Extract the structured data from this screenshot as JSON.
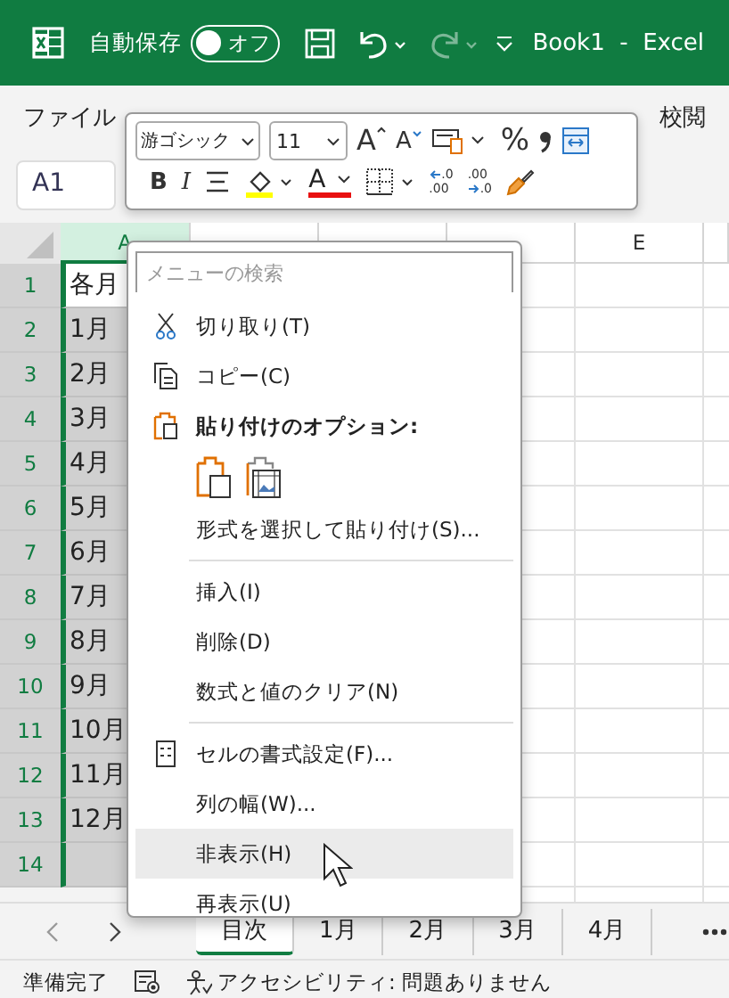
{
  "title_bar": {
    "autosave_label": "自動保存",
    "autosave": {
      "label": "オフ",
      "on": false
    },
    "redo_disabled": true,
    "title": "Book1  -  Excel"
  },
  "ribbon_tabs": [
    {
      "label": "ファイル"
    },
    {
      "label": "校閲"
    }
  ],
  "name_box": "A1",
  "mini_toolbar": {
    "font_name": "游ゴシック",
    "font_size": "11",
    "grow_font": "A",
    "shrink_font": "A",
    "percent": "%",
    "bold": "B",
    "italic": "I",
    "font_color": "A",
    "increase_decimal": {
      "upper": ".0",
      "lower": ".00"
    },
    "decrease_decimal": {
      "upper": ".00",
      "lower": ".0"
    }
  },
  "columns": [
    {
      "label": "A",
      "selected": true
    },
    {
      "label": "E",
      "selected": false
    }
  ],
  "rows": [
    {
      "number": "1",
      "value": "各月",
      "active": true
    },
    {
      "number": "2",
      "value": "1月",
      "active": false
    },
    {
      "number": "3",
      "value": "2月",
      "active": false
    },
    {
      "number": "4",
      "value": "3月",
      "active": false
    },
    {
      "number": "5",
      "value": "4月",
      "active": false
    },
    {
      "number": "6",
      "value": "5月",
      "active": false
    },
    {
      "number": "7",
      "value": "6月",
      "active": false
    },
    {
      "number": "8",
      "value": "7月",
      "active": false
    },
    {
      "number": "9",
      "value": "8月",
      "active": false
    },
    {
      "number": "10",
      "value": "9月",
      "active": false
    },
    {
      "number": "11",
      "value": "10月",
      "active": false
    },
    {
      "number": "12",
      "value": "11月",
      "active": false
    },
    {
      "number": "13",
      "value": "12月",
      "active": false
    },
    {
      "number": "14",
      "active": false
    }
  ],
  "context_menu": {
    "search_placeholder": "メニューの検索",
    "items": [
      {
        "kind": "cut",
        "label": "切り取り(T)",
        "hovered": false
      },
      {
        "kind": "copy",
        "label": "コピー(C)",
        "hovered": false
      },
      {
        "kind": "heading",
        "label": "貼り付けのオプション:",
        "hovered": false
      },
      {
        "kind": "paste-options"
      },
      {
        "kind": "plain",
        "label": "形式を選択して貼り付け(S)...",
        "hovered": false
      },
      {
        "kind": "separator"
      },
      {
        "kind": "plain",
        "label": "挿入(I)",
        "hovered": false
      },
      {
        "kind": "plain",
        "label": "削除(D)",
        "hovered": false
      },
      {
        "kind": "plain",
        "label": "数式と値のクリア(N)",
        "hovered": false
      },
      {
        "kind": "separator"
      },
      {
        "kind": "format",
        "label": "セルの書式設定(F)...",
        "hovered": false
      },
      {
        "kind": "plain",
        "label": "列の幅(W)...",
        "hovered": false
      },
      {
        "kind": "plain",
        "label": "非表示(H)",
        "hovered": true
      },
      {
        "kind": "plain",
        "label": "再表示(U)",
        "hovered": false
      }
    ]
  },
  "sheet_tabs": [
    {
      "label": "目次",
      "selected": true
    },
    {
      "label": "1月",
      "selected": false
    },
    {
      "label": "2月",
      "selected": false
    },
    {
      "label": "3月",
      "selected": false
    },
    {
      "label": "4月",
      "selected": false
    }
  ],
  "status_bar": {
    "ready": "準備完了",
    "accessibility": "アクセシビリティ: 問題ありません"
  }
}
